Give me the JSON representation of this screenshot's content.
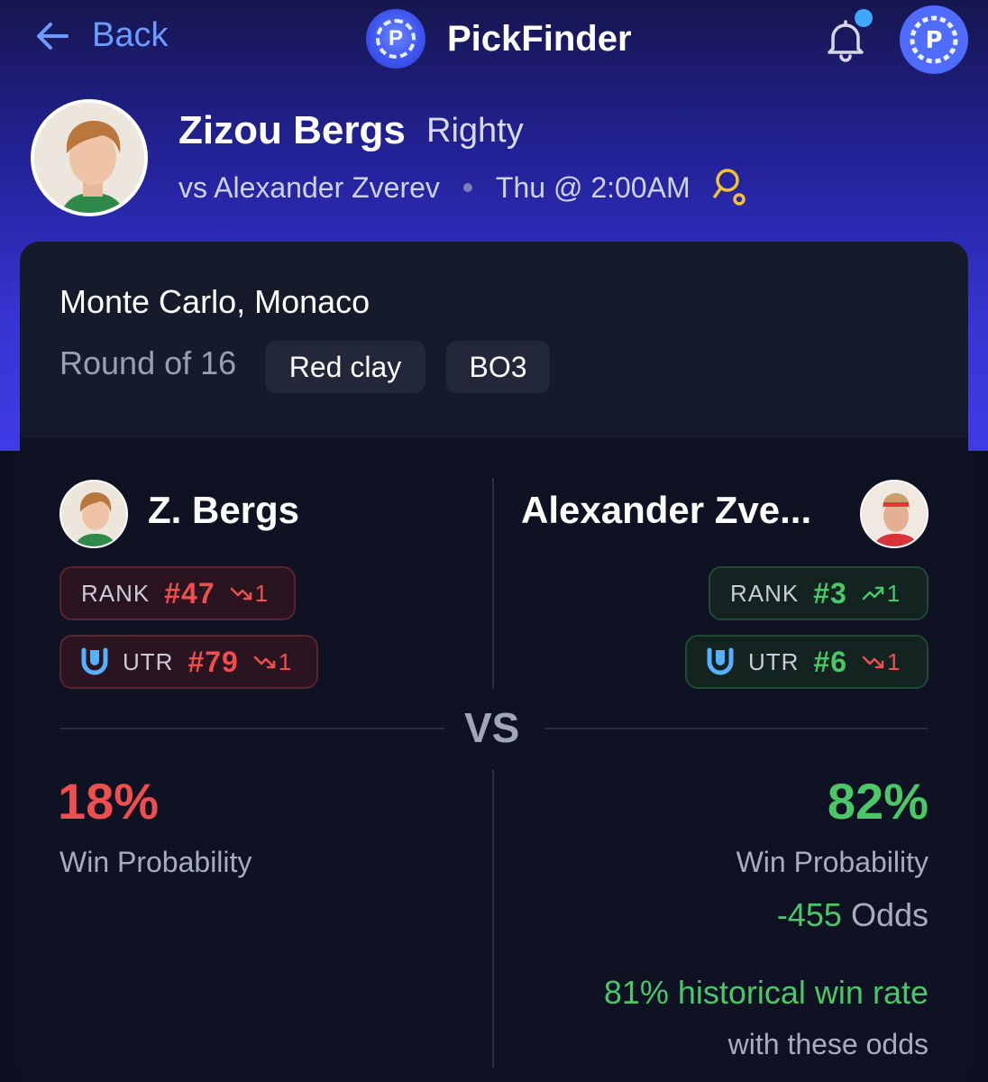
{
  "nav": {
    "back_label": "Back",
    "brand": "PickFinder",
    "logo_letter": "P"
  },
  "player": {
    "name": "Zizou Bergs",
    "handedness": "Righty",
    "opponent": "vs Alexander Zverev",
    "time": "Thu @ 2:00AM"
  },
  "match": {
    "venue": "Monte Carlo, Monaco",
    "round": "Round of 16",
    "surface": "Red clay",
    "format": "BO3"
  },
  "left": {
    "name": "Z. Bergs",
    "rank_label": "RANK",
    "rank": "#47",
    "rank_trend": "1",
    "rank_trend_dir": "down",
    "utr_label": "UTR",
    "utr": "#79",
    "utr_trend": "1",
    "utr_trend_dir": "down",
    "win_pct": "18%",
    "win_label": "Win Probability"
  },
  "right": {
    "name": "Alexander Zve...",
    "rank_label": "RANK",
    "rank": "#3",
    "rank_trend": "1",
    "rank_trend_dir": "up",
    "utr_label": "UTR",
    "utr": "#6",
    "utr_trend": "1",
    "utr_trend_dir": "down",
    "win_pct": "82%",
    "win_label": "Win Probability",
    "odds_value": "-455",
    "odds_label": "Odds",
    "historical": "81% historical win rate",
    "historical_sub": "with these odds"
  },
  "vs_label": "VS",
  "colors": {
    "accent_blue": "#6d9bff",
    "negative": "#ef4e4e",
    "positive": "#4cc767",
    "card_bg": "#0e1222",
    "header_gradient_end": "#3f3ce6"
  }
}
